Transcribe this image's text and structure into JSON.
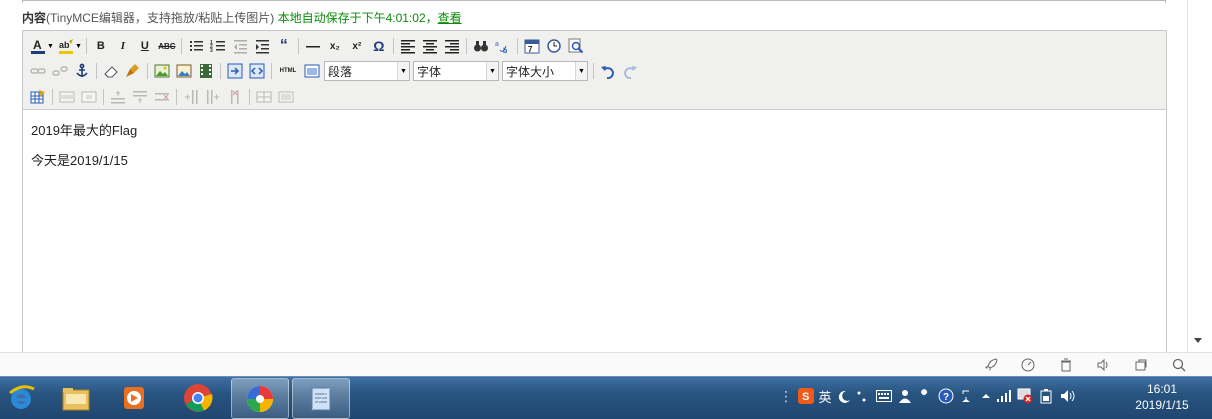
{
  "form": {
    "label": "内容",
    "hint": "(TinyMCE编辑器，支持拖放/粘贴上传图片)",
    "autosave": "本地自动保存于下午4:01:02，",
    "view_link": "查看"
  },
  "toolbar": {
    "row1": {
      "bold": "B",
      "italic": "I",
      "underline": "U",
      "strike": "ABC",
      "quote": "“",
      "subscript": "x₂",
      "superscript": "x²",
      "omega": "Ω"
    },
    "row2": {
      "html": "HTML",
      "format_select": "段落",
      "font_select": "字体",
      "size_select": "字体大小"
    }
  },
  "content": {
    "paragraphs": [
      "2019年最大的Flag",
      "今天是2019/1/15"
    ]
  },
  "tray": {
    "ime_lang": "英",
    "time": "16:01",
    "date": "2019/1/15"
  },
  "colors": {
    "accent_green": "#0a8a0a",
    "toolbar_bg": "#f0f0ee",
    "taskbar": "#28547f"
  }
}
